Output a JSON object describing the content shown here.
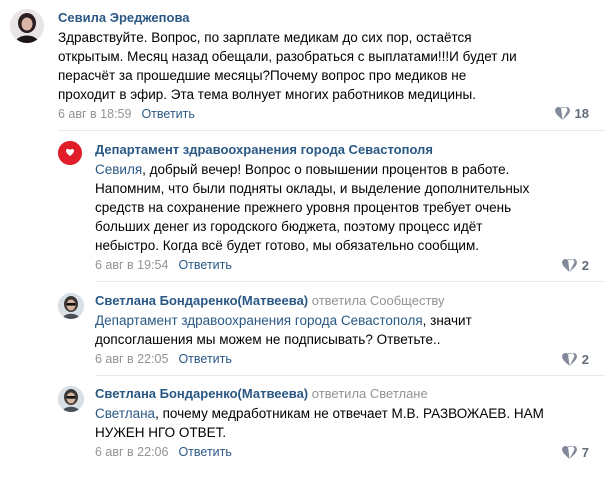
{
  "comments": [
    {
      "author": "Севила Эреджепова",
      "reply_to": "",
      "text_lines": [
        "Здравствуйте. Вопрос, по зарплате медикам до сих пор, остаётся",
        "открытым. Месяц назад обещали, разобраться с выплатами!!!И будет ли",
        "перасчёт за прошедшие месяцы?Почему вопрос про медиков не",
        "проходит в эфир. Эта тема волнует многих работников медицины."
      ],
      "date": "6 авг в 18:59",
      "reply_label": "Ответить",
      "likes": "18"
    },
    {
      "author": "Департамент здравоохранения города Севастополя",
      "reply_to": "",
      "mention": "Севиля",
      "text_lines": [
        ", добрый вечер! Вопрос о повышении процентов в работе.",
        "Напомним, что были подняты оклады, и выделение дополнительных",
        "средств на сохранение прежнего уровня процентов требует очень",
        "больших денег из городского бюджета, поэтому процесс идёт",
        "небыстро. Когда всё будет готово, мы обязательно сообщим."
      ],
      "date": "6 авг в 19:54",
      "reply_label": "Ответить",
      "likes": "2"
    },
    {
      "author": "Светлана Бондаренко(Матвеева)",
      "reply_to": "ответила Сообществу",
      "mention": "Департамент здравоохранения города Севастополя",
      "text_lines": [
        ", значит",
        "допсоглашения мы можем не подписывать? Ответьте.."
      ],
      "date": "6 авг в 22:05",
      "reply_label": "Ответить",
      "likes": "2"
    },
    {
      "author": "Светлана Бондаренко(Матвеева)",
      "reply_to": "ответила Светлане",
      "mention": "Светлана",
      "text_lines": [
        ", почему медработникам не отвечает М.В. РАЗВОЖАЕВ. НАМ",
        "НУЖЕН НГО ОТВЕТ."
      ],
      "date": "6 авг в 22:06",
      "reply_label": "Ответить",
      "likes": "7"
    }
  ],
  "colors": {
    "link": "#2a5885",
    "meta": "#939393",
    "like_icon": "#828a99",
    "dept_logo": "#e11d2b"
  },
  "icons": {
    "like": "heart-icon",
    "dept_logo": "health-cross-logo-icon"
  }
}
